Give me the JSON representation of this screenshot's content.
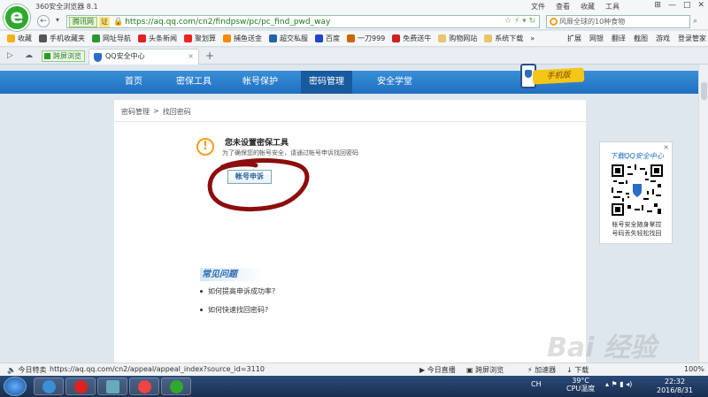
{
  "browser": {
    "title": "360安全浏览器 8.1",
    "menu": [
      "文件",
      "查看",
      "收藏",
      "工具"
    ],
    "win_buttons": [
      "⊞",
      "—",
      "□",
      "✕"
    ],
    "url_tag": "腾讯网",
    "url_cert": "证",
    "url": "https://aq.qq.com/cn2/findpsw/pc/pc_find_pwd_way",
    "search_text": "风靡全球的10种食物",
    "bookmarks": [
      {
        "label": "收藏",
        "color": "#f2b21a"
      },
      {
        "label": "手机收藏夹",
        "color": "#555"
      },
      {
        "label": "网址导航",
        "color": "#2a9a2a"
      },
      {
        "label": "头条新闻",
        "color": "#d22"
      },
      {
        "label": "聚划算",
        "color": "#e22"
      },
      {
        "label": "捕鱼送金",
        "color": "#f80"
      },
      {
        "label": "超交私服",
        "color": "#26a"
      },
      {
        "label": "百度",
        "color": "#24c"
      },
      {
        "label": "一刀999",
        "color": "#c60"
      },
      {
        "label": "免费送牛",
        "color": "#c22"
      },
      {
        "label": "购物网站",
        "color": "#e9c46a"
      },
      {
        "label": "系统下载",
        "color": "#e9c46a"
      }
    ],
    "bookmark_more": "»",
    "right_tools": [
      "扩展",
      "网银",
      "翻译",
      "截图",
      "游戏",
      "登录管家"
    ],
    "tab_pill": "跨屏浏览",
    "active_tab": "QQ安全中心",
    "tab_close": "×",
    "tab_plus": "+"
  },
  "page": {
    "nav": [
      {
        "label": "首页",
        "active": false
      },
      {
        "label": "密保工具",
        "active": false
      },
      {
        "label": "帐号保护",
        "active": false
      },
      {
        "label": "密码管理",
        "active": true
      },
      {
        "label": "安全学堂",
        "active": false
      }
    ],
    "badge": "手机版",
    "breadcrumb": [
      "密码管理",
      ">",
      "找回密码"
    ],
    "warning_icon": "!",
    "warning_title": "您未设置密保工具",
    "warning_desc": "为了确保您的帐号安全，请通过帐号申诉找回密码",
    "appeal_button": "帐号申诉",
    "faq_title": "常见问题",
    "faq_items": [
      "如何提高申诉成功率?",
      "如何快速找回密码?"
    ],
    "qr_title": "下载QQ安全中心",
    "qr_desc_1": "帐号安全随身掌控",
    "qr_desc_2": "号码丢失轻松找回",
    "qr_close": "×"
  },
  "status": {
    "left": "今日特卖",
    "hover_url": "https://aq.qq.com/cn2/appeal/appeal_index?source_id=3110",
    "live": "今日直播",
    "cross": "跨屏浏览",
    "accel": "加速器",
    "download": "下载",
    "zoom": "100%"
  },
  "taskbar": {
    "tray_lang": "CH",
    "temp": "39°C",
    "cpu": "CPU温度",
    "time": "22:32",
    "date": "2016/8/31"
  },
  "watermark": "Bai 经验"
}
